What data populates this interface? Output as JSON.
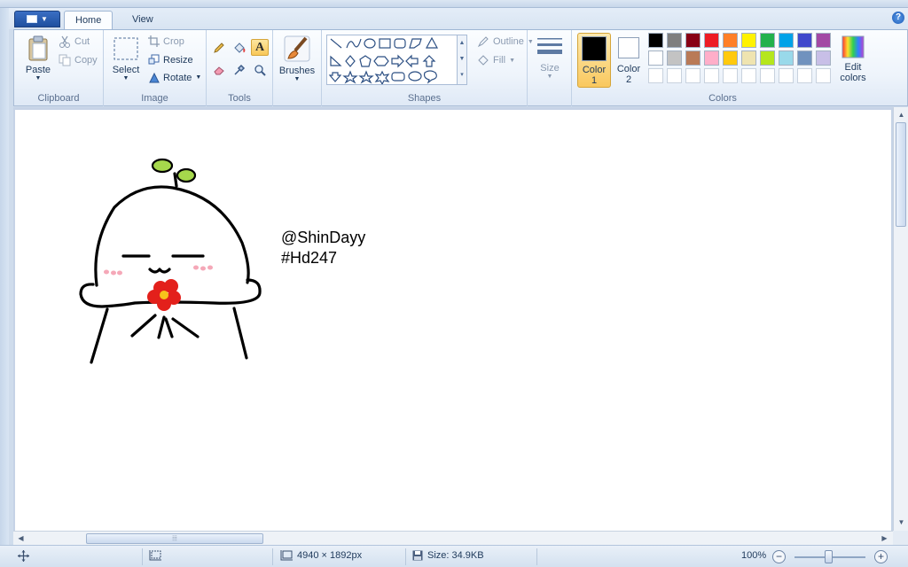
{
  "tabs": {
    "home": "Home",
    "view": "View"
  },
  "help_label": "?",
  "clipboard": {
    "paste": "Paste",
    "cut": "Cut",
    "copy": "Copy",
    "group": "Clipboard"
  },
  "image": {
    "select": "Select",
    "crop": "Crop",
    "resize": "Resize",
    "rotate": "Rotate",
    "group": "Image"
  },
  "tools": {
    "group": "Tools",
    "text_glyph": "A"
  },
  "brushes": {
    "label": "Brushes"
  },
  "shapes": {
    "outline": "Outline",
    "fill": "Fill",
    "group": "Shapes"
  },
  "size": {
    "label": "Size"
  },
  "colors": {
    "color1": "Color",
    "color1_num": "1",
    "color2": "Color",
    "color2_num": "2",
    "edit": "Edit",
    "edit2": "colors",
    "group": "Colors",
    "color1_value": "#000000",
    "color2_value": "#ffffff",
    "row1": [
      "#000000",
      "#7f7f7f",
      "#880015",
      "#ed1c24",
      "#ff7f27",
      "#fff200",
      "#22b14c",
      "#00a2e8",
      "#3f48cc",
      "#a349a4"
    ],
    "row2": [
      "#ffffff",
      "#c3c3c3",
      "#b97a57",
      "#ffaec9",
      "#ffc90e",
      "#efe4b0",
      "#b5e61d",
      "#99d9ea",
      "#7092be",
      "#c8bfe7"
    ],
    "row3": [
      "#ffffff",
      "#ffffff",
      "#ffffff",
      "#ffffff",
      "#ffffff",
      "#ffffff",
      "#ffffff",
      "#ffffff",
      "#ffffff",
      "#ffffff"
    ]
  },
  "canvas_text": {
    "line1": "@ShinDayy",
    "line2": "#Hd247"
  },
  "status": {
    "dimensions": "4940 × 1892px",
    "size": "Size: 34.9KB",
    "zoom": "100%"
  }
}
